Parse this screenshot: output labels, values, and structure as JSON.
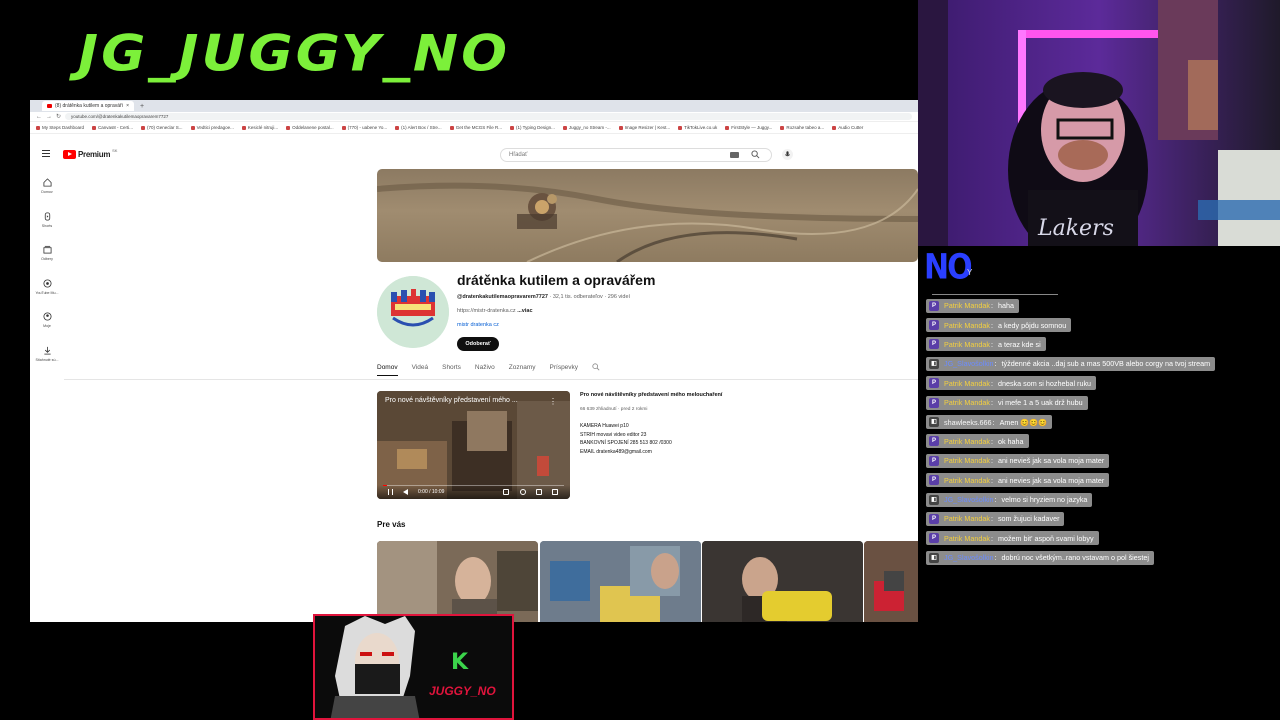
{
  "stream": {
    "title": "JG_JUGGY_NO",
    "overlay_brand": "K",
    "overlay_name": "JUGGY_NO"
  },
  "browser": {
    "tab_title": "(8) drátěnka kutilem a opraváři",
    "new_tab": "+",
    "url": "youtube.com/@dratenkakutilemaopravarem7727",
    "bookmarks": [
      "My Steps Dashboard",
      "Canvas8 - Certi...",
      "(70) Geneclar S...",
      "Vedtici predagoe...",
      "Kesiclé nitruji...",
      "Oddelanene postal...",
      "(770) - uabene Yo...",
      "(1) Alert Box / Stre...",
      "Get the MCGS File R...",
      "(1) Typing Design...",
      "Juggy_no Stream -...",
      "Image Resizer | Kest...",
      "TikTokLive.co.uk",
      "FirstStyle — Juggy...",
      "Rozsahe tabeo a...",
      "Audio Cutter"
    ]
  },
  "youtube": {
    "brand": "Premium",
    "brand_sup": "SK",
    "search_placeholder": "Hľadať",
    "sidebar": [
      {
        "label": "Domov",
        "icon": "home-icon"
      },
      {
        "label": "Shorts",
        "icon": "shorts-icon"
      },
      {
        "label": "Odbery",
        "icon": "subscriptions-icon"
      },
      {
        "label": "YouTube Mu...",
        "icon": "music-icon"
      },
      {
        "label": "Moje",
        "icon": "user-icon"
      },
      {
        "label": "Stiahnuté sú...",
        "icon": "download-icon"
      }
    ],
    "channel": {
      "name": "drátěnka kutilem a opravářem",
      "handle": "@dratenkakutilemaopravarem7727",
      "subscribers": "32,1 tis. odberateľov",
      "videos": "296 videí",
      "link": "https://mistr-dratenka.cz",
      "more": "...viac",
      "shop_link": "mistr dratenka cz",
      "subscribe_label": "Odoberať"
    },
    "tabs": [
      "Domov",
      "Videá",
      "Shorts",
      "Naživo",
      "Zoznamy",
      "Príspevky"
    ],
    "featured": {
      "overlay_title": "Pro nové návštěvníky představení mého ...",
      "time": "0:00 / 10:09",
      "title": "Pro nové návštěvníky představení mého melouchaření",
      "meta": "66 639 zhliadnutí · pred 2 rokmi",
      "desc_lines": [
        "KAMERA Huawei p10",
        "STRIH movavi video editor 23",
        "BANKOVNÍ SPOJENÍ 285 513 802 /0300",
        "EMAIL dratenka489@gmail.com"
      ]
    },
    "section_title": "Pre vás",
    "next_label": "›"
  },
  "chat": {
    "logo": "NO",
    "logo_suffix": "Y",
    "messages": [
      {
        "badge": "P",
        "user": "Patrik Mandak",
        "text": "haha",
        "ucls": "yellow"
      },
      {
        "badge": "P",
        "user": "Patrik Mandak",
        "text": "a kedy pôjdu somnou",
        "ucls": "yellow"
      },
      {
        "badge": "P",
        "user": "Patrik Mandak",
        "text": "a teraz kde si",
        "ucls": "yellow"
      },
      {
        "badge": "◧",
        "user": "JG_Slavošolkin",
        "text": "týždenné akcia ..daj sub a mas 500VB alebo corgy na tvoj stream",
        "ucls": "blue"
      },
      {
        "badge": "P",
        "user": "Patrik Mandak",
        "text": "dneska som si hozhebal ruku",
        "ucls": "yellow"
      },
      {
        "badge": "P",
        "user": "Patrik Mandak",
        "text": "vi mefe 1 a 5 uak drž hubu",
        "ucls": "yellow"
      },
      {
        "badge": "◧",
        "user": "shawleeks.666",
        "text": "Amen 😊😊😊",
        "ucls": "grey"
      },
      {
        "badge": "P",
        "user": "Patrik Mandak",
        "text": "ok haha",
        "ucls": "yellow"
      },
      {
        "badge": "P",
        "user": "Patrik Mandak",
        "text": "ani nevieš jak sa vola moja mater",
        "ucls": "yellow"
      },
      {
        "badge": "P",
        "user": "Patrik Mandak",
        "text": "ani nevies jak sa vola moja mater",
        "ucls": "yellow"
      },
      {
        "badge": "◧",
        "user": "JG_Slavošolkin",
        "text": "velmo si hryziem no jazyka",
        "ucls": "blue"
      },
      {
        "badge": "P",
        "user": "Patrik Mandak",
        "text": "som žujuci kadaver",
        "ucls": "yellow"
      },
      {
        "badge": "P",
        "user": "Patrik Mandak",
        "text": "možem bit' aspoň svami lobyy",
        "ucls": "yellow"
      },
      {
        "badge": "◧",
        "user": "JG_Slavošolkin",
        "text": "dobrú noc všetkým..rano vstavam o pol šiestej",
        "ucls": "blue"
      }
    ]
  }
}
